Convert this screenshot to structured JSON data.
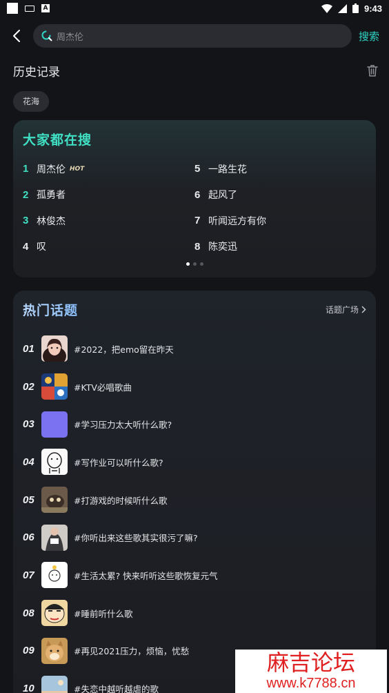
{
  "status_bar": {
    "time": "9:43",
    "icons": [
      "notification-square-icon",
      "keyboard-icon",
      "a-icon",
      "wifi-icon",
      "signal-icon",
      "battery-icon"
    ]
  },
  "search": {
    "placeholder": "周杰伦",
    "button_label": "搜索"
  },
  "history": {
    "title": "历史记录",
    "items": [
      "花海"
    ]
  },
  "trending": {
    "title": "大家都在搜",
    "hot_badge": "HOT",
    "items": [
      {
        "rank": "1",
        "text": "周杰伦"
      },
      {
        "rank": "5",
        "text": "一路生花"
      },
      {
        "rank": "2",
        "text": "孤勇者"
      },
      {
        "rank": "6",
        "text": "起风了"
      },
      {
        "rank": "3",
        "text": "林俊杰"
      },
      {
        "rank": "7",
        "text": "听闻远方有你"
      },
      {
        "rank": "4",
        "text": "叹"
      },
      {
        "rank": "8",
        "text": "陈奕迅"
      }
    ],
    "page_count": 3,
    "active_page": 1
  },
  "topics": {
    "title": "热门话题",
    "plaza_label": "话题广场",
    "items": [
      {
        "num": "01",
        "text": "#2022，把emo留在昨天",
        "thumb": "portrait-girl"
      },
      {
        "num": "02",
        "text": "#KTV必唱歌曲",
        "thumb": "ktv-collage"
      },
      {
        "num": "03",
        "text": "#学习压力太大听什么歌?",
        "thumb": "purple-square"
      },
      {
        "num": "04",
        "text": "#写作业可以听什么歌?",
        "thumb": "sketch-character"
      },
      {
        "num": "05",
        "text": "#打游戏的时候听什么歌",
        "thumb": "cat-photo"
      },
      {
        "num": "06",
        "text": "#你听出来这些歌其实很污了嘛?",
        "thumb": "fashion-photo"
      },
      {
        "num": "07",
        "text": "#生活太累? 快来听听这些歌恢复元气",
        "thumb": "cute-doodle"
      },
      {
        "num": "08",
        "text": "#睡前听什么歌",
        "thumb": "cartoon-boy"
      },
      {
        "num": "09",
        "text": "#再见2021压力，烦恼，忧愁",
        "thumb": "shiba-dog"
      },
      {
        "num": "10",
        "text": "#失恋中越听越虐的歌",
        "thumb": "beach-scene"
      }
    ]
  },
  "watermark": {
    "title": "麻吉论坛",
    "url": "www.k7788.cn"
  },
  "colors": {
    "accent": "#2fd7c6",
    "background": "#131418",
    "card": "#1d1e22",
    "watermark_red": "#e02020"
  }
}
